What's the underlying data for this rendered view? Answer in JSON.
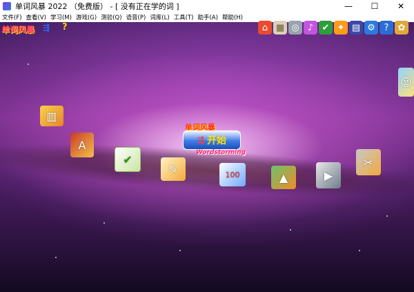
{
  "window": {
    "title": "单词风暴 2022 （免费版） - [ 没有正在学的词 ]",
    "minimize": "—",
    "maximize": "☐",
    "close": "✕"
  },
  "menu": {
    "items": [
      "文件(F)",
      "查看(V)",
      "学习(M)",
      "游戏(G)",
      "测验(Q)",
      "语音(P)",
      "词库(L)",
      "工具(T)",
      "助手(A)",
      "帮助(H)"
    ]
  },
  "header": {
    "logo_text": "单词风暴",
    "logo_icon_glyph": "⇶",
    "help_glyph": "?"
  },
  "toolbar": {
    "tools": [
      {
        "name": "home-icon",
        "glyph": "⌂",
        "color": "#e94b2f"
      },
      {
        "name": "grid-icon",
        "glyph": "▦",
        "color": "#d9d2b8"
      },
      {
        "name": "disc-icon",
        "glyph": "◎",
        "color": "#9aa3ad"
      },
      {
        "name": "music-icon",
        "glyph": "♪",
        "color": "#c455e0"
      },
      {
        "name": "shield-icon",
        "glyph": "✔",
        "color": "#2e9e3b"
      },
      {
        "name": "runner-icon",
        "glyph": "✦",
        "color": "#ff9a1a"
      },
      {
        "name": "document-icon",
        "glyph": "▤",
        "color": "#3a4aa8"
      },
      {
        "name": "settings-icon",
        "glyph": "⚙",
        "color": "#2b7ae0"
      },
      {
        "name": "help-icon",
        "glyph": "?",
        "color": "#2b6cd6"
      },
      {
        "name": "bird-icon",
        "glyph": "✿",
        "color": "#e0a83a"
      }
    ]
  },
  "center": {
    "title": "单词风暴",
    "start_label": "开始",
    "start_arrow": "⇶",
    "subtitle": "Wordstorming"
  },
  "desktop_icons": {
    "books": "▥",
    "dictionary": "A",
    "checklist": "✔",
    "notes": "✎",
    "test": "100",
    "chart": "▲",
    "player": "▶",
    "tools": "✂",
    "mascot": "☺"
  }
}
